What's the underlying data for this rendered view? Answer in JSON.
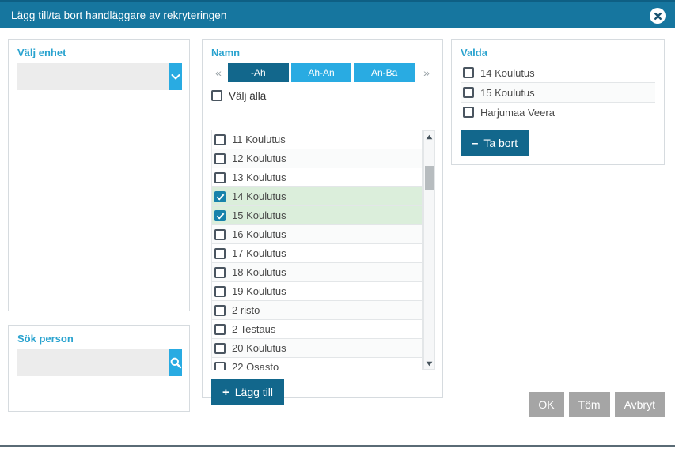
{
  "titlebar": {
    "title": "Lägg till/ta bort handläggare av rekryteringen",
    "close_icon": "close-icon"
  },
  "unit_panel": {
    "label": "Välj enhet",
    "input_value": "",
    "input_placeholder": "",
    "dropdown_icon": "chevron-down-icon"
  },
  "search_panel": {
    "label": "Sök person",
    "input_value": "",
    "input_placeholder": "",
    "search_icon": "search-icon"
  },
  "names_panel": {
    "label": "Namn",
    "pager": {
      "prev_label": "«",
      "next_label": "»",
      "tabs": [
        {
          "label": "-Ah",
          "active": true
        },
        {
          "label": "Ah-An",
          "active": false
        },
        {
          "label": "An-Ba",
          "active": false
        }
      ]
    },
    "select_all_label": "Välj alla",
    "select_all_checked": false,
    "items": [
      {
        "label": "11 Koulutus",
        "checked": false
      },
      {
        "label": "12 Koulutus",
        "checked": false
      },
      {
        "label": "13 Koulutus",
        "checked": false
      },
      {
        "label": "14 Koulutus",
        "checked": true
      },
      {
        "label": "15 Koulutus",
        "checked": true
      },
      {
        "label": "16 Koulutus",
        "checked": false
      },
      {
        "label": "17 Koulutus",
        "checked": false
      },
      {
        "label": "18 Koulutus",
        "checked": false
      },
      {
        "label": "19 Koulutus",
        "checked": false
      },
      {
        "label": "2 risto",
        "checked": false
      },
      {
        "label": "2 Testaus",
        "checked": false
      },
      {
        "label": "20 Koulutus",
        "checked": false
      },
      {
        "label": "22 Osasto",
        "checked": false
      }
    ],
    "add_button": {
      "symbol": "+",
      "label": "Lägg till"
    },
    "scroll_up_icon": "triangle-up-icon",
    "scroll_down_icon": "triangle-down-icon"
  },
  "selected_panel": {
    "label": "Valda",
    "items": [
      {
        "label": "14 Koulutus",
        "checked": false
      },
      {
        "label": "15 Koulutus",
        "checked": false
      },
      {
        "label": "Harjumaa Veera",
        "checked": false
      }
    ],
    "remove_button": {
      "symbol": "–",
      "label": "Ta bort"
    }
  },
  "footer": {
    "buttons": [
      {
        "label": "OK"
      },
      {
        "label": "Töm"
      },
      {
        "label": "Avbryt"
      }
    ]
  },
  "colors": {
    "titlebar": "#16769f",
    "accent_light": "#29abe2",
    "accent_dark": "#12678c",
    "label": "#2aa3cf",
    "selected_row": "#dbeedb",
    "gray_button": "#a5a5a5"
  }
}
